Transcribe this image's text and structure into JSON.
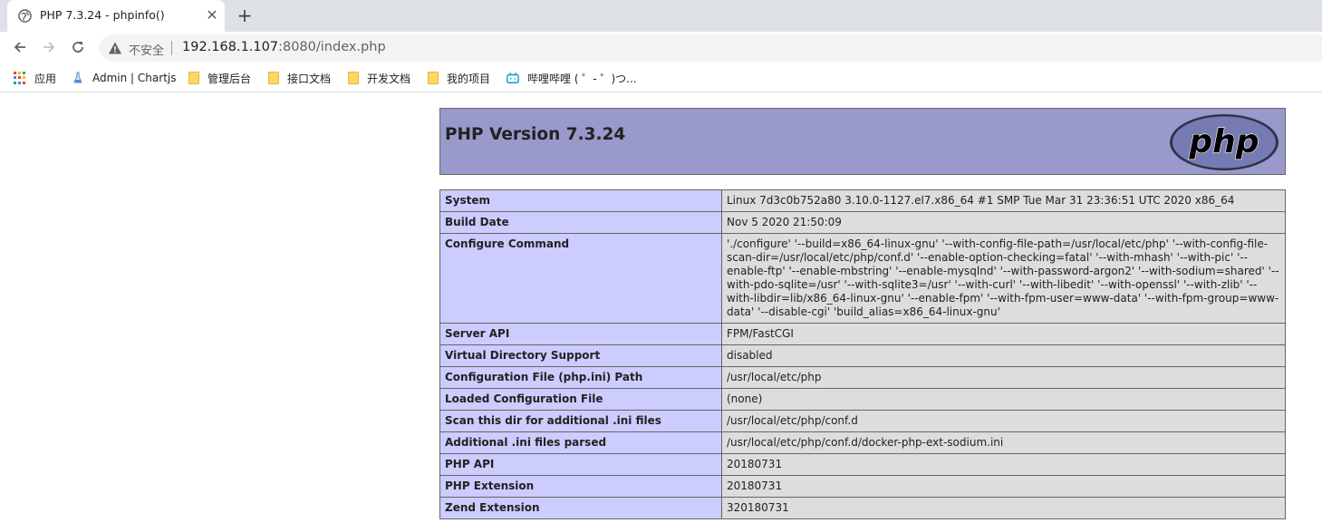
{
  "tab": {
    "title": "PHP 7.3.24 - phpinfo()",
    "close_glyph": "✕",
    "newtab_glyph": "+"
  },
  "toolbar": {
    "insecure_label": "不安全",
    "url_host": "192.168.1.107",
    "url_rest": ":8080/index.php"
  },
  "bookmarks": [
    {
      "label": "应用",
      "icon": "apps-icon"
    },
    {
      "label": "Admin | Chartjs",
      "icon": "chartjs-icon"
    },
    {
      "label": "管理后台",
      "icon": "folder-icon"
    },
    {
      "label": "接口文档",
      "icon": "folder-icon"
    },
    {
      "label": "开发文档",
      "icon": "folder-icon"
    },
    {
      "label": "我的项目",
      "icon": "folder-icon"
    },
    {
      "label": "哔哩哔哩 ( ゜- ゜)つ...",
      "icon": "bilibili-icon"
    }
  ],
  "php": {
    "title": "PHP Version 7.3.24",
    "logo_text": "php",
    "rows": [
      {
        "key": "System",
        "value": "Linux 7d3c0b752a80 3.10.0-1127.el7.x86_64 #1 SMP Tue Mar 31 23:36:51 UTC 2020 x86_64"
      },
      {
        "key": "Build Date",
        "value": "Nov 5 2020 21:50:09"
      },
      {
        "key": "Configure Command",
        "value": "'./configure' '--build=x86_64-linux-gnu' '--with-config-file-path=/usr/local/etc/php' '--with-config-file-scan-dir=/usr/local/etc/php/conf.d' '--enable-option-checking=fatal' '--with-mhash' '--with-pic' '--enable-ftp' '--enable-mbstring' '--enable-mysqlnd' '--with-password-argon2' '--with-sodium=shared' '--with-pdo-sqlite=/usr' '--with-sqlite3=/usr' '--with-curl' '--with-libedit' '--with-openssl' '--with-zlib' '--with-libdir=lib/x86_64-linux-gnu' '--enable-fpm' '--with-fpm-user=www-data' '--with-fpm-group=www-data' '--disable-cgi' 'build_alias=x86_64-linux-gnu'"
      },
      {
        "key": "Server API",
        "value": "FPM/FastCGI"
      },
      {
        "key": "Virtual Directory Support",
        "value": "disabled"
      },
      {
        "key": "Configuration File (php.ini) Path",
        "value": "/usr/local/etc/php"
      },
      {
        "key": "Loaded Configuration File",
        "value": "(none)"
      },
      {
        "key": "Scan this dir for additional .ini files",
        "value": "/usr/local/etc/php/conf.d"
      },
      {
        "key": "Additional .ini files parsed",
        "value": "/usr/local/etc/php/conf.d/docker-php-ext-sodium.ini"
      },
      {
        "key": "PHP API",
        "value": "20180731"
      },
      {
        "key": "PHP Extension",
        "value": "20180731"
      },
      {
        "key": "Zend Extension",
        "value": "320180731"
      }
    ]
  },
  "colors": {
    "header_bg": "#9999cc",
    "key_bg": "#ccccff",
    "value_bg": "#dddddd",
    "logo_fill": "#777bb3"
  }
}
